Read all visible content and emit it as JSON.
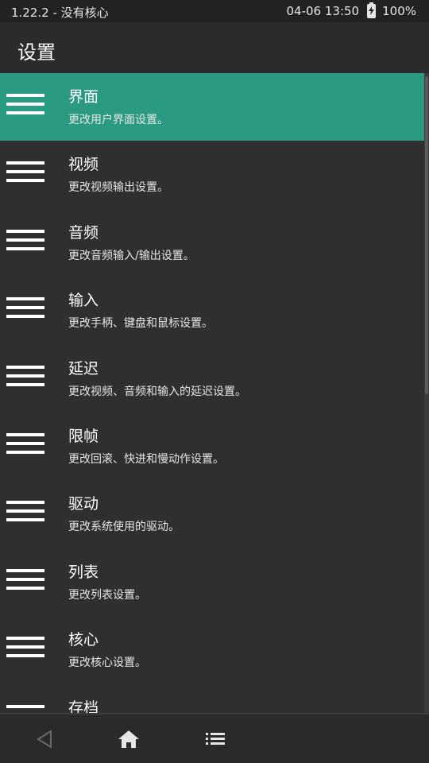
{
  "status": {
    "left": "1.22.2 - 没有核心",
    "datetime": "04-06 13:50",
    "battery": "100%"
  },
  "app_bar": {
    "title": "设置"
  },
  "settings": {
    "items": [
      {
        "title": "界面",
        "subtitle": "更改用户界面设置。"
      },
      {
        "title": "视频",
        "subtitle": "更改视频输出设置。"
      },
      {
        "title": "音频",
        "subtitle": "更改音频输入/输出设置。"
      },
      {
        "title": "输入",
        "subtitle": "更改手柄、键盘和鼠标设置。"
      },
      {
        "title": "延迟",
        "subtitle": "更改视频、音频和输入的延迟设置。"
      },
      {
        "title": "限帧",
        "subtitle": "更改回滚、快进和慢动作设置。"
      },
      {
        "title": "驱动",
        "subtitle": "更改系统使用的驱动。"
      },
      {
        "title": "列表",
        "subtitle": "更改列表设置。"
      },
      {
        "title": "核心",
        "subtitle": "更改核心设置。"
      },
      {
        "title": "存档",
        "subtitle": ""
      }
    ]
  },
  "icons": {
    "item": "menu-lines-icon",
    "nav_back": "back-triangle-icon",
    "nav_home": "home-icon",
    "nav_menu": "list-icon",
    "battery": "battery-charging-icon"
  },
  "colors": {
    "accent": "#2b9a83",
    "background": "#2f2f2f",
    "app_bar": "#2b2b2b",
    "status_bar": "#222222"
  }
}
